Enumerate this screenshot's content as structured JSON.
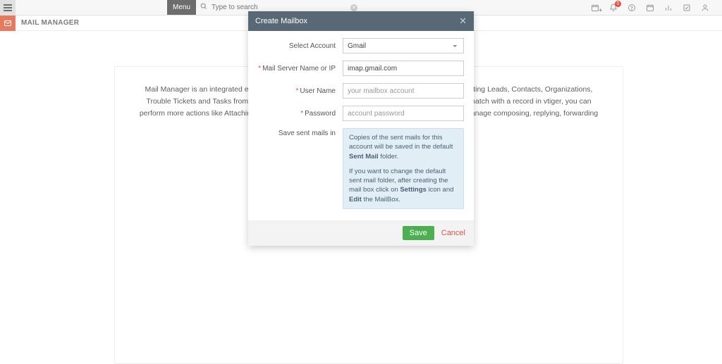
{
  "top": {
    "menu_label": "Menu",
    "search_placeholder": "Type to search",
    "notification_count": "0"
  },
  "page": {
    "title": "MAIL MANAGER",
    "intro": "Mail Manager is an integrated email client that allows users to perform CRM related actions like creating Leads, Contacts, Organizations, Trouble Tickets and Tasks from the emails that you receive in your inbox. Should sender's email id match with a record in vtiger, you can perform more actions like Attaching Email, Adding Task, Comment and Ticket. Additionally, you can manage composing, replying, forwarding emails etc too."
  },
  "modal": {
    "title": "Create Mailbox",
    "labels": {
      "select_account": "Select Account",
      "mail_server": "Mail Server Name or IP",
      "user_name": "User Name",
      "password": "Password",
      "save_sent": "Save sent mails in"
    },
    "values": {
      "select_account": "Gmail",
      "mail_server": "imap.gmail.com"
    },
    "placeholders": {
      "user_name": "your mailbox account",
      "password": "account password"
    },
    "info": {
      "p1_a": "Copies of the sent mails for this account will be saved in the default ",
      "p1_b": "Sent Mail",
      "p1_c": " folder.",
      "p2_a": "If you want to change the default sent mail folder, after creating the mail box click on ",
      "p2_b": "Settings",
      "p2_c": " icon and ",
      "p2_d": "Edit",
      "p2_e": " the MailBox."
    },
    "buttons": {
      "save": "Save",
      "cancel": "Cancel"
    }
  }
}
